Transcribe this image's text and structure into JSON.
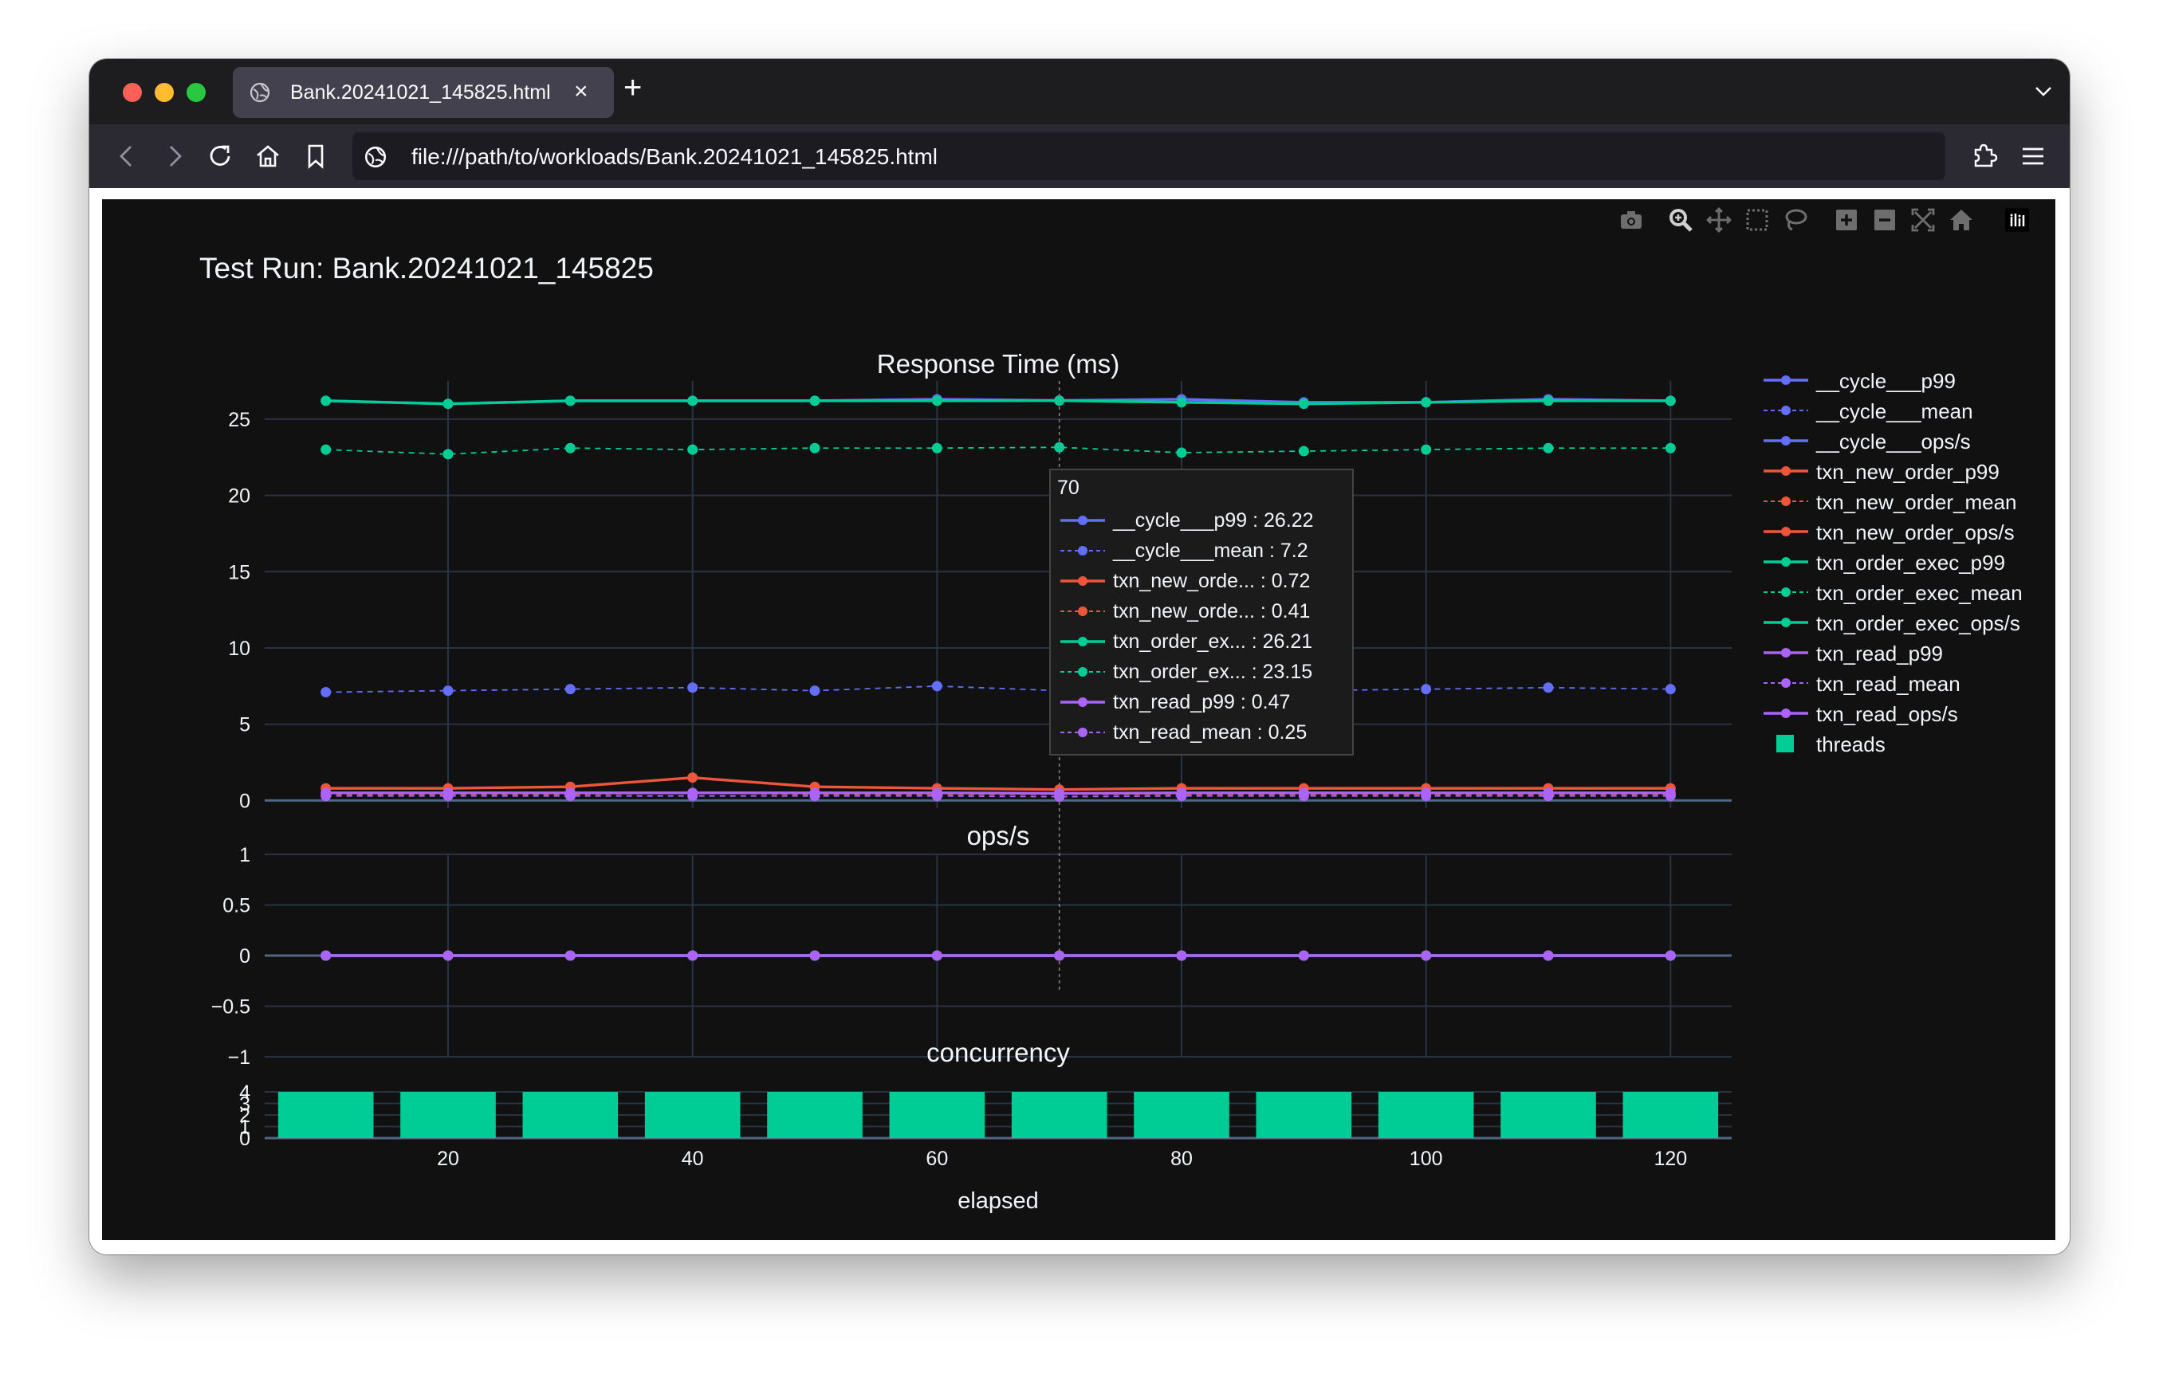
{
  "browser": {
    "tab_title": "Bank.20241021_145825.html",
    "url": "file:///path/to/workloads/Bank.20241021_145825.html",
    "new_tab_symbol": "+",
    "close_symbol": "×"
  },
  "plot": {
    "title": "Test Run: Bank.20241021_145825",
    "modebar_icons": [
      "camera-icon",
      "zoom-icon",
      "pan-icon",
      "box-select-icon",
      "lasso-icon",
      "zoom-in-icon",
      "zoom-out-icon",
      "autoscale-icon",
      "reset-axes-icon",
      "plotly-logo-icon"
    ],
    "colors": {
      "background": "#111111",
      "grid": "#283442",
      "text": "#f2f5fa",
      "cycle": "#636efa",
      "new_order": "#ef553b",
      "order_exec": "#00cc96",
      "read": "#ab63fa",
      "threads": "#00cc96"
    },
    "legend": [
      {
        "label": "__cycle___p99",
        "color": "#636efa",
        "dash": "solid",
        "marker": "circle"
      },
      {
        "label": "__cycle___mean",
        "color": "#636efa",
        "dash": "dash",
        "marker": "circle"
      },
      {
        "label": "__cycle___ops/s",
        "color": "#636efa",
        "dash": "solid",
        "marker": "circle"
      },
      {
        "label": "txn_new_order_p99",
        "color": "#ef553b",
        "dash": "solid",
        "marker": "circle"
      },
      {
        "label": "txn_new_order_mean",
        "color": "#ef553b",
        "dash": "dash",
        "marker": "circle"
      },
      {
        "label": "txn_new_order_ops/s",
        "color": "#ef553b",
        "dash": "solid",
        "marker": "circle"
      },
      {
        "label": "txn_order_exec_p99",
        "color": "#00cc96",
        "dash": "solid",
        "marker": "circle"
      },
      {
        "label": "txn_order_exec_mean",
        "color": "#00cc96",
        "dash": "dash",
        "marker": "circle"
      },
      {
        "label": "txn_order_exec_ops/s",
        "color": "#00cc96",
        "dash": "solid",
        "marker": "circle"
      },
      {
        "label": "txn_read_p99",
        "color": "#ab63fa",
        "dash": "solid",
        "marker": "circle"
      },
      {
        "label": "txn_read_mean",
        "color": "#ab63fa",
        "dash": "dash",
        "marker": "circle"
      },
      {
        "label": "txn_read_ops/s",
        "color": "#ab63fa",
        "dash": "solid",
        "marker": "circle"
      },
      {
        "label": "threads",
        "color": "#00cc96",
        "dash": "none",
        "marker": "square"
      }
    ],
    "tooltip": {
      "header": "70",
      "rows": [
        {
          "label": "__cycle___p99 : 26.22",
          "color": "#636efa",
          "dash": "solid"
        },
        {
          "label": "__cycle___mean : 7.2",
          "color": "#636efa",
          "dash": "dash"
        },
        {
          "label": "txn_new_orde... : 0.72",
          "color": "#ef553b",
          "dash": "solid"
        },
        {
          "label": "txn_new_orde... : 0.41",
          "color": "#ef553b",
          "dash": "dash"
        },
        {
          "label": "txn_order_ex... : 26.21",
          "color": "#00cc96",
          "dash": "solid"
        },
        {
          "label": "txn_order_ex... : 23.15",
          "color": "#00cc96",
          "dash": "dash"
        },
        {
          "label": "txn_read_p99 : 0.47",
          "color": "#ab63fa",
          "dash": "solid"
        },
        {
          "label": "txn_read_mean : 0.25",
          "color": "#ab63fa",
          "dash": "dash"
        }
      ]
    }
  },
  "chart_data": [
    {
      "type": "line",
      "title": "Response Time (ms)",
      "xlabel": "",
      "ylabel": "",
      "x": [
        10,
        20,
        30,
        40,
        50,
        60,
        70,
        80,
        90,
        100,
        110,
        120
      ],
      "ylim": [
        -0.5,
        27.5
      ],
      "y_ticks": [
        0,
        5,
        10,
        15,
        20,
        25
      ],
      "grid": true,
      "legend_position": "right",
      "series": [
        {
          "name": "__cycle___p99",
          "color": "#636efa",
          "dash": "solid",
          "values": [
            26.2,
            26.0,
            26.2,
            26.2,
            26.2,
            26.3,
            26.22,
            26.3,
            26.1,
            26.1,
            26.3,
            26.2
          ]
        },
        {
          "name": "__cycle___mean",
          "color": "#636efa",
          "dash": "dash",
          "values": [
            7.1,
            7.2,
            7.3,
            7.4,
            7.2,
            7.5,
            7.2,
            7.3,
            7.2,
            7.3,
            7.4,
            7.3
          ]
        },
        {
          "name": "txn_new_order_p99",
          "color": "#ef553b",
          "dash": "solid",
          "values": [
            0.8,
            0.8,
            0.9,
            1.5,
            0.9,
            0.8,
            0.72,
            0.8,
            0.8,
            0.8,
            0.8,
            0.8
          ]
        },
        {
          "name": "txn_new_order_mean",
          "color": "#ef553b",
          "dash": "dash",
          "values": [
            0.4,
            0.4,
            0.4,
            0.5,
            0.4,
            0.4,
            0.41,
            0.4,
            0.4,
            0.4,
            0.4,
            0.4
          ]
        },
        {
          "name": "txn_order_exec_p99",
          "color": "#00cc96",
          "dash": "solid",
          "values": [
            26.2,
            26.0,
            26.2,
            26.2,
            26.2,
            26.2,
            26.21,
            26.1,
            26.0,
            26.1,
            26.2,
            26.2
          ]
        },
        {
          "name": "txn_order_exec_mean",
          "color": "#00cc96",
          "dash": "dash",
          "values": [
            23.0,
            22.7,
            23.1,
            23.0,
            23.1,
            23.1,
            23.15,
            22.8,
            22.9,
            23.0,
            23.1,
            23.1
          ]
        },
        {
          "name": "txn_read_p99",
          "color": "#ab63fa",
          "dash": "solid",
          "values": [
            0.5,
            0.5,
            0.5,
            0.5,
            0.5,
            0.5,
            0.47,
            0.5,
            0.5,
            0.5,
            0.5,
            0.5
          ]
        },
        {
          "name": "txn_read_mean",
          "color": "#ab63fa",
          "dash": "dash",
          "values": [
            0.3,
            0.3,
            0.3,
            0.3,
            0.3,
            0.3,
            0.25,
            0.3,
            0.3,
            0.3,
            0.3,
            0.3
          ]
        }
      ]
    },
    {
      "type": "line",
      "title": "ops/s",
      "xlabel": "",
      "ylabel": "",
      "x": [
        10,
        20,
        30,
        40,
        50,
        60,
        70,
        80,
        90,
        100,
        110,
        120
      ],
      "ylim": [
        -1,
        1
      ],
      "y_ticks": [
        -1,
        -0.5,
        0,
        0.5,
        1
      ],
      "y_tick_labels": [
        "−1",
        "−0.5",
        "0",
        "0.5",
        "1"
      ],
      "grid": true,
      "series": [
        {
          "name": "__cycle___ops/s",
          "color": "#636efa",
          "values": [
            0,
            0,
            0,
            0,
            0,
            0,
            0,
            0,
            0,
            0,
            0,
            0
          ]
        },
        {
          "name": "txn_new_order_ops/s",
          "color": "#ef553b",
          "values": [
            0,
            0,
            0,
            0,
            0,
            0,
            0,
            0,
            0,
            0,
            0,
            0
          ]
        },
        {
          "name": "txn_order_exec_ops/s",
          "color": "#00cc96",
          "values": [
            0,
            0,
            0,
            0,
            0,
            0,
            0,
            0,
            0,
            0,
            0,
            0
          ]
        },
        {
          "name": "txn_read_ops/s",
          "color": "#ab63fa",
          "values": [
            0,
            0,
            0,
            0,
            0,
            0,
            0,
            0,
            0,
            0,
            0,
            0
          ]
        }
      ]
    },
    {
      "type": "bar",
      "title": "concurrency",
      "xlabel": "elapsed",
      "ylabel": "",
      "x": [
        10,
        20,
        30,
        40,
        50,
        60,
        70,
        80,
        90,
        100,
        110,
        120
      ],
      "x_ticks": [
        20,
        40,
        60,
        80,
        100,
        120
      ],
      "ylim": [
        0,
        4
      ],
      "y_ticks": [
        0,
        1,
        2,
        3,
        4
      ],
      "grid": true,
      "series": [
        {
          "name": "threads",
          "color": "#00cc96",
          "values": [
            4,
            4,
            4,
            4,
            4,
            4,
            4,
            4,
            4,
            4,
            4,
            4
          ]
        }
      ]
    }
  ]
}
